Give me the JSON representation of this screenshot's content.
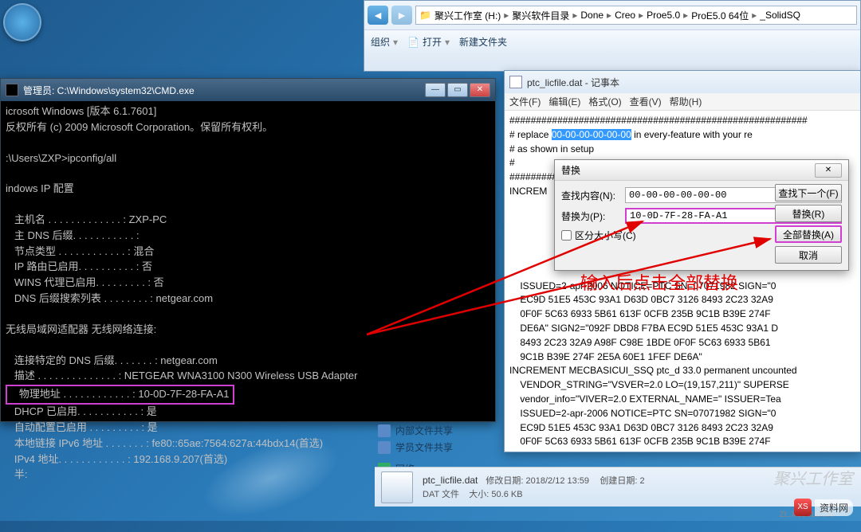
{
  "explorer": {
    "breadcrumb": [
      "聚兴工作室 (H:)",
      "聚兴软件目录",
      "Done",
      "Creo",
      "Proe5.0",
      "ProE5.0 64位",
      "_SolidSQ"
    ],
    "toolbar": {
      "organize": "组织",
      "open": "打开",
      "newfolder": "新建文件夹"
    },
    "side": {
      "internal": "内部文件共享",
      "student": "学员文件共享",
      "network": "网络"
    },
    "file": {
      "name": "ptc_licfile.dat",
      "type": "DAT 文件",
      "mod_label": "修改日期:",
      "mod": "2018/2/12 13:59",
      "size_label": "大小:",
      "size": "50.6 KB",
      "created_label": "创建日期:",
      "created": "2"
    }
  },
  "cmd": {
    "title": "管理员: C:\\Windows\\system32\\CMD.exe",
    "lines": {
      "l1": "icrosoft Windows [版本 6.1.7601]",
      "l2": "反权所有 (c) 2009 Microsoft Corporation。保留所有权利。",
      "l3": ":\\Users\\ZXP>ipconfig/all",
      "l4": "indows IP 配置",
      "host": "   主机名 . . . . . . . . . . . . . : ZXP-PC",
      "dns": "   主 DNS 后缀. . . . . . . . . . . :",
      "node": "   节点类型 . . . . . . . . . . . . : 混合",
      "iprt": "   IP 路由已启用. . . . . . . . . . : 否",
      "wins": "   WINS 代理已启用. . . . . . . . . : 否",
      "dnssl": "   DNS 后缀搜索列表 . . . . . . . . : netgear.com",
      "adp": "无线局域网适配器 无线网络连接:",
      "cdns": "   连接特定的 DNS 后缀. . . . . . . : netgear.com",
      "desc": "   描述 . . . . . . . . . . . . . . : NETGEAR WNA3100 N300 Wireless USB Adapter",
      "phys": "   物理地址 . . . . . . . . . . . . : 10-0D-7F-28-FA-A1",
      "dhcp": "   DHCP 已启用. . . . . . . . . . . : 是",
      "auto": "   自动配置已启用 . . . . . . . . . : 是",
      "ipv6": "   本地链接 IPv6 地址 . . . . . . . : fe80::65ae:7564:627a:44bdx14(首选)",
      "ipv4": "   IPv4 地址. . . . . . . . . . . . : 192.168.9.207(首选)",
      "half": "   半:"
    }
  },
  "notepad": {
    "title": "ptc_licfile.dat - 记事本",
    "menu": {
      "file": "文件(F)",
      "edit": "编辑(E)",
      "format": "格式(O)",
      "view": "查看(V)",
      "help": "帮助(H)"
    },
    "body": {
      "l1": "########################################################",
      "l2a": "# replace ",
      "l2sel": "00-00-00-00-00-00",
      "l2b": " in every-feature with your re",
      "l3": "# as shown in setup",
      "l4": "#",
      "l5": "########################################################",
      "l6": "INCREM",
      "b1": "    ISSUED=2-apr-2006 NOTICE=PTC SN=07071982 SIGN=\"0",
      "b2": "    EC9D 51E5 453C 93A1 D63D 0BC7 3126 8493 2C23 32A9",
      "b3": "    0F0F 5C63 6933 5B61 613F 0CFB 235B 9C1B B39E 274F",
      "b4": "    DE6A\" SIGN2=\"092F DBD8 F7BA EC9D 51E5 453C 93A1 D",
      "b5": "    8493 2C23 32A9 A98F C98E 1BDE 0F0F 5C63 6933 5B61",
      "b6": "    9C1B B39E 274F 2E5A 60E1 1FEF DE6A\"",
      "b7": "INCREMENT MECBASICUI_SSQ ptc_d 33.0 permanent uncounted",
      "b8": "    VENDOR_STRING=\"VSVER=2.0 LO=(19,157,211)\" SUPERSE",
      "b9": "    vendor_info=\"VIVER=2.0 EXTERNAL_NAME=\" ISSUER=Tea",
      "b10": "    ISSUED=2-apr-2006 NOTICE=PTC SN=07071982 SIGN=\"0",
      "b11": "    EC9D 51E5 453C 93A1 D63D 0BC7 3126 8493 2C23 32A9",
      "b12": "    0F0F 5C63 6933 5B61 613F 0CFB 235B 9C1B B39E 274F"
    }
  },
  "replace": {
    "title": "替换",
    "find_label": "查找内容(N):",
    "find_value": "00-00-00-00-00-00",
    "replace_label": "替换为(P):",
    "replace_value": "10-0D-7F-28-FA-A1",
    "case": "区分大小写(C)",
    "btn_findnext": "查找下一个(F)",
    "btn_replace": "替换(R)",
    "btn_replaceall": "全部替换(A)",
    "btn_cancel": "取消"
  },
  "annotation": "输入后点击全部替换",
  "watermark": {
    "text1": "聚兴工作室",
    "text2": "资料网",
    "url": "ZL.XS1616.CN"
  }
}
